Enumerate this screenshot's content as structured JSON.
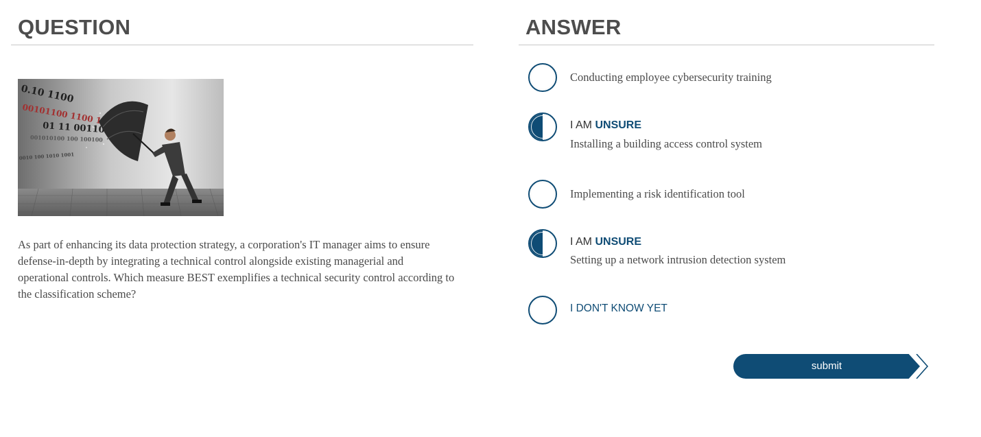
{
  "question": {
    "heading": "QUESTION",
    "image_alt": "businessman shielding with umbrella from binary code",
    "binary_lines": [
      "0.10 1100",
      "00101100 1100 10 10",
      "01 11 00110",
      "001010100 100 100100",
      "0010 100 1010 1001"
    ],
    "text": "As part of enhancing its data protection strategy, a corporation's IT manager aims to ensure defense-in-depth by integrating a technical control alongside existing managerial and operational controls. Which measure BEST exemplifies a technical security control according to the classification scheme?"
  },
  "answer": {
    "heading": "ANSWER",
    "unsure_prefix": "I AM ",
    "unsure_word": "UNSURE",
    "options": [
      {
        "label": "Conducting employee cybersecurity training",
        "state": "empty"
      },
      {
        "label": "Installing a building access control system",
        "state": "unsure"
      },
      {
        "label": "Implementing a risk identification tool",
        "state": "empty"
      },
      {
        "label": "Setting up a network intrusion detection system",
        "state": "unsure"
      }
    ],
    "dont_know": "I DON'T KNOW YET",
    "submit_label": "submit"
  },
  "colors": {
    "accent": "#0f4c75",
    "text": "#4a4a4a",
    "heading": "#4d4d4d",
    "rule": "#c8c8c8"
  },
  "icons": {
    "radio_empty": "radio-empty-icon",
    "radio_half": "radio-half-filled-icon",
    "chevron": "chevron-right-icon"
  }
}
